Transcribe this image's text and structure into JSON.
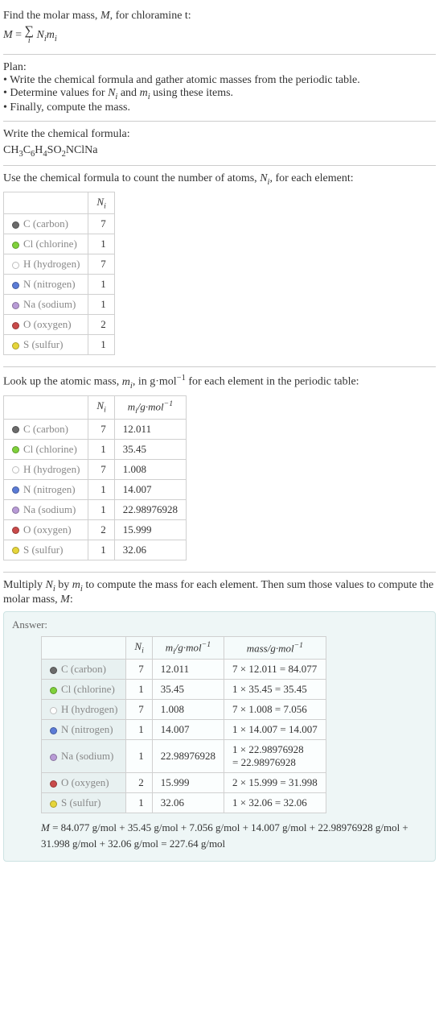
{
  "intro": {
    "line1_a": "Find the molar mass, ",
    "line1_b": ", for chloramine t:",
    "formula_lhs": "M = ",
    "formula_sigma": "∑",
    "formula_sub": "i",
    "formula_rhs_a": " N",
    "formula_rhs_b": "m"
  },
  "plan": {
    "title": "Plan:",
    "b1": "• Write the chemical formula and gather atomic masses from the periodic table.",
    "b2_a": "• Determine values for ",
    "b2_b": " and ",
    "b2_c": " using these items.",
    "b3": "• Finally, compute the mass."
  },
  "chem": {
    "title": "Write the chemical formula:",
    "f1": "CH",
    "s1": "3",
    "f2": "C",
    "s2": "6",
    "f3": "H",
    "s3": "4",
    "f4": "SO",
    "s4": "2",
    "f5": "NClNa"
  },
  "count": {
    "title_a": "Use the chemical formula to count the number of atoms, ",
    "title_b": ", for each element:",
    "hdr_N": "N",
    "hdr_i": "i"
  },
  "elements": [
    {
      "color": "#6b6b6b",
      "label": "C (carbon)",
      "N": "7",
      "m": "12.011",
      "mass": "7 × 12.011 = 84.077"
    },
    {
      "color": "#7fd13b",
      "label": "Cl (chlorine)",
      "N": "1",
      "m": "35.45",
      "mass": "1 × 35.45 = 35.45"
    },
    {
      "color": "#ffffff",
      "label": "H (hydrogen)",
      "N": "7",
      "m": "1.008",
      "mass": "7 × 1.008 = 7.056"
    },
    {
      "color": "#5b7bd6",
      "label": "N (nitrogen)",
      "N": "1",
      "m": "14.007",
      "mass": "1 × 14.007 = 14.007"
    },
    {
      "color": "#b89bd6",
      "label": "Na (sodium)",
      "N": "1",
      "m": "22.98976928",
      "mass_a": "1 × 22.98976928",
      "mass_b": "= 22.98976928"
    },
    {
      "color": "#c94a4a",
      "label": "O (oxygen)",
      "N": "2",
      "m": "15.999",
      "mass": "2 × 15.999 = 31.998"
    },
    {
      "color": "#e6d53a",
      "label": "S (sulfur)",
      "N": "1",
      "m": "32.06",
      "mass": "1 × 32.06 = 32.06"
    }
  ],
  "lookup": {
    "title_a": "Look up the atomic mass, ",
    "title_b": ", in g·mol",
    "title_c": " for each element in the periodic table:",
    "neg1": "−1",
    "m_hdr": "m",
    "unit": "/g·mol"
  },
  "multiply": {
    "title_a": "Multiply ",
    "title_b": " by ",
    "title_c": " to compute the mass for each element. Then sum those values to compute the molar mass, ",
    "title_d": ":"
  },
  "answer": {
    "label": "Answer:",
    "mass_hdr": "mass/g·mol",
    "final_a": "M",
    "final_b": " = 84.077 g/mol + 35.45 g/mol + 7.056 g/mol + 14.007 g/mol + 22.98976928 g/mol + 31.998 g/mol + 32.06 g/mol = 227.64 g/mol"
  }
}
